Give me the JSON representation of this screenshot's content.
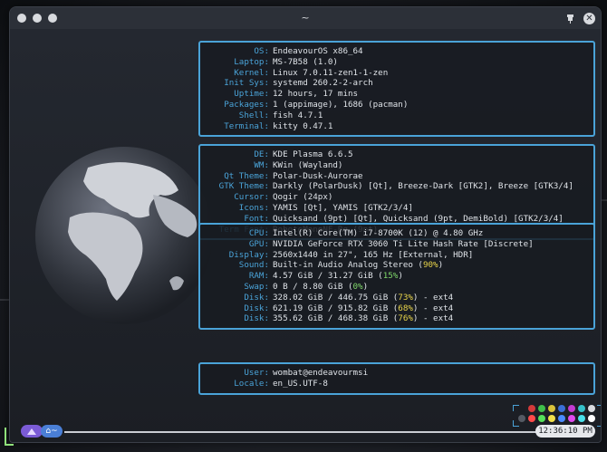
{
  "window": {
    "title": "~"
  },
  "colors": {
    "accent": "#4aa3d8",
    "value_text": "#dfe3e8",
    "ok": "#7fd66a",
    "warn": "#e8d44a"
  },
  "system": [
    {
      "key": "OS",
      "value": "EndeavourOS x86_64"
    },
    {
      "key": "Laptop",
      "value": "MS-7B58 (1.0)"
    },
    {
      "key": "Kernel",
      "value": "Linux 7.0.11-zen1-1-zen"
    },
    {
      "key": "Init Sys",
      "value": "systemd 260.2-2-arch"
    },
    {
      "key": "Uptime",
      "value": "12 hours, 17 mins"
    },
    {
      "key": "Packages",
      "value": "1 (appimage), 1686 (pacman)"
    },
    {
      "key": "Shell",
      "value": "fish 4.7.1"
    },
    {
      "key": "Terminal",
      "value": "kitty 0.47.1"
    }
  ],
  "desktop": [
    {
      "key": "DE",
      "value": "KDE Plasma 6.6.5"
    },
    {
      "key": "WM",
      "value": "KWin (Wayland)"
    },
    {
      "key": "Qt Theme",
      "value": "Polar-Dusk-Aurorae"
    },
    {
      "key": "GTK Theme",
      "value": "Darkly (PolarDusk) [Qt], Breeze-Dark [GTK2], Breeze [GTK3/4]"
    },
    {
      "key": "Cursor",
      "value": "Qogir (24px)"
    },
    {
      "key": "Icons",
      "value": "YAMIS [Qt], YAMIS [GTK2/3/4]"
    },
    {
      "key": "Font",
      "value": "Quicksand (9pt) [Qt], Quicksand (9pt, DemiBold) [GTK2/3/4]"
    },
    {
      "key": "Term Font",
      "value": "RobotoMonoNF-Rg (9pt)"
    }
  ],
  "hardware": [
    {
      "key": "CPU",
      "value": "Intel(R) Core(TM) i7-8700K (12) @ 4.80 GHz"
    },
    {
      "key": "GPU",
      "value": "NVIDIA GeForce RTX 3060 Ti Lite Hash Rate [Discrete]"
    },
    {
      "key": "Display",
      "value": "2560x1440 in 27\", 165 Hz [External, HDR]"
    },
    {
      "key": "Sound",
      "pre": "Built-in Audio Analog Stereo (",
      "pct": "90%",
      "post": ")",
      "level": "warn"
    },
    {
      "key": "RAM",
      "pre": "4.57 GiB / 31.27 GiB (",
      "pct": "15%",
      "post": ")",
      "level": "ok"
    },
    {
      "key": "Swap",
      "pre": "0 B / 8.80 GiB (",
      "pct": "0%",
      "post": ")",
      "level": "ok"
    },
    {
      "key": "Disk",
      "pre": "328.02 GiB / 446.75 GiB (",
      "pct": "73%",
      "post": ") - ext4",
      "level": "warn"
    },
    {
      "key": "Disk",
      "pre": "621.19 GiB / 915.82 GiB (",
      "pct": "68%",
      "post": ") - ext4",
      "level": "warn"
    },
    {
      "key": "Disk",
      "pre": "355.62 GiB / 468.38 GiB (",
      "pct": "76%",
      "post": ") - ext4",
      "level": "warn"
    }
  ],
  "user": [
    {
      "key": "User",
      "value": "wombat@endeavourmsi"
    },
    {
      "key": "Locale",
      "value": "en_US.UTF-8"
    }
  ],
  "palette": {
    "row1": [
      "#1b1e24",
      "#d33a3a",
      "#3fbf4a",
      "#d8c23a",
      "#3a6fd6",
      "#c23ad0",
      "#35c0c8",
      "#d8dade"
    ],
    "row2": [
      "#555a63",
      "#ff4a4a",
      "#55e05a",
      "#f2e04a",
      "#4a8aff",
      "#e04aee",
      "#4ae0ea",
      "#ffffff"
    ]
  },
  "statusbar": {
    "home_label": "~",
    "clock": "12:36:10 PM"
  }
}
